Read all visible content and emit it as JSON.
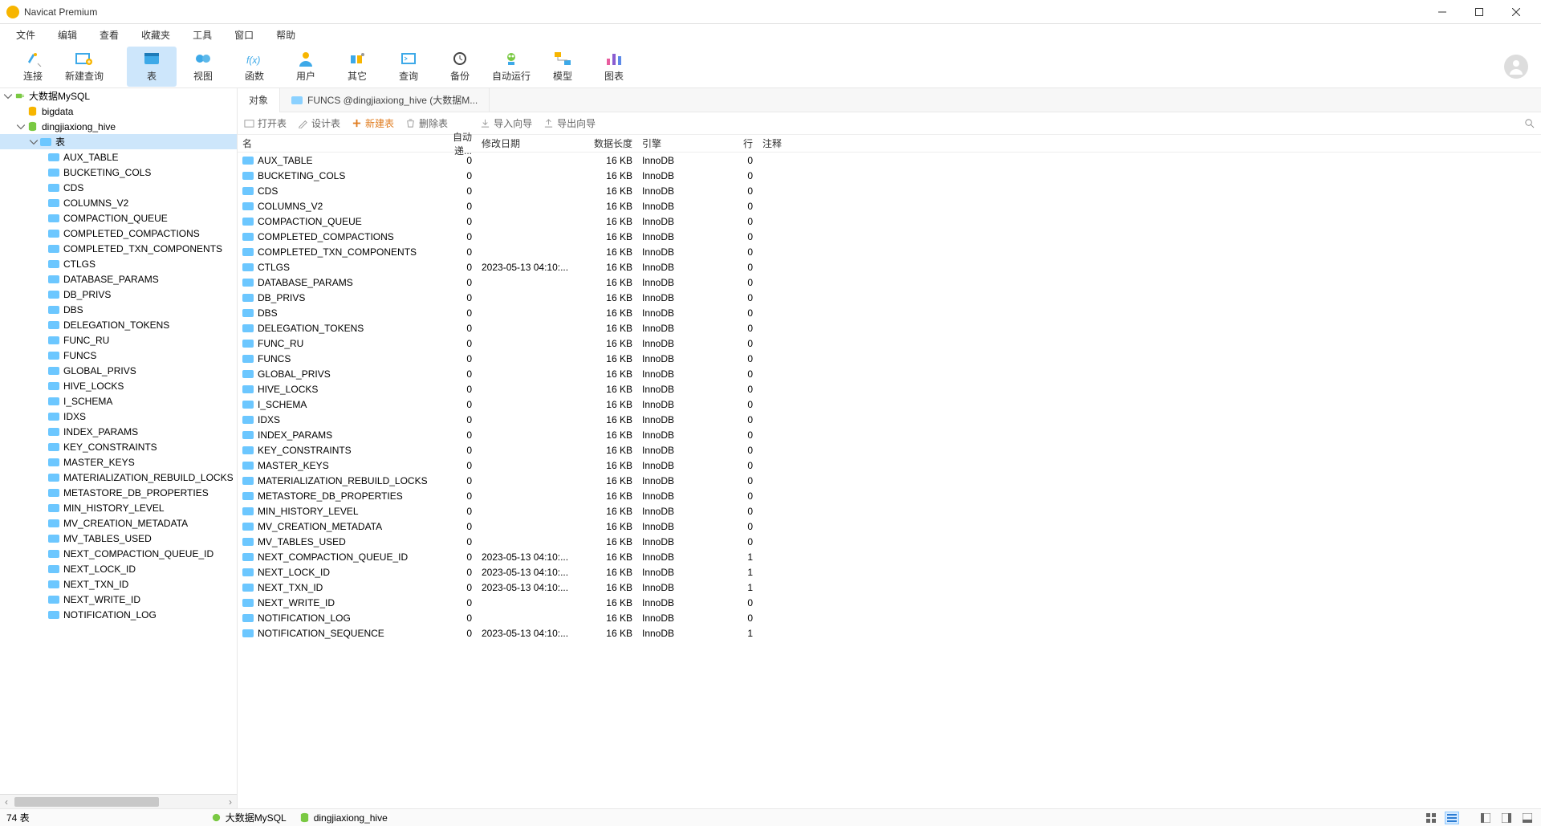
{
  "window": {
    "title": "Navicat Premium"
  },
  "menu": [
    "文件",
    "编辑",
    "查看",
    "收藏夹",
    "工具",
    "窗口",
    "帮助"
  ],
  "toolbar": [
    {
      "label": "连接",
      "key": "conn"
    },
    {
      "label": "新建查询",
      "key": "newq"
    },
    {
      "label": "表",
      "key": "table",
      "selected": true
    },
    {
      "label": "视图",
      "key": "view"
    },
    {
      "label": "函数",
      "key": "func"
    },
    {
      "label": "用户",
      "key": "user"
    },
    {
      "label": "其它",
      "key": "other"
    },
    {
      "label": "查询",
      "key": "query"
    },
    {
      "label": "备份",
      "key": "backup"
    },
    {
      "label": "自动运行",
      "key": "auto"
    },
    {
      "label": "模型",
      "key": "model"
    },
    {
      "label": "图表",
      "key": "chart"
    }
  ],
  "tree": {
    "root_label": "大数据MySQL",
    "db1_label": "bigdata",
    "db2_label": "dingjiaxiong_hive",
    "tables_label": "表",
    "tables": [
      "AUX_TABLE",
      "BUCKETING_COLS",
      "CDS",
      "COLUMNS_V2",
      "COMPACTION_QUEUE",
      "COMPLETED_COMPACTIONS",
      "COMPLETED_TXN_COMPONENTS",
      "CTLGS",
      "DATABASE_PARAMS",
      "DB_PRIVS",
      "DBS",
      "DELEGATION_TOKENS",
      "FUNC_RU",
      "FUNCS",
      "GLOBAL_PRIVS",
      "HIVE_LOCKS",
      "I_SCHEMA",
      "IDXS",
      "INDEX_PARAMS",
      "KEY_CONSTRAINTS",
      "MASTER_KEYS",
      "MATERIALIZATION_REBUILD_LOCKS",
      "METASTORE_DB_PROPERTIES",
      "MIN_HISTORY_LEVEL",
      "MV_CREATION_METADATA",
      "MV_TABLES_USED",
      "NEXT_COMPACTION_QUEUE_ID",
      "NEXT_LOCK_ID",
      "NEXT_TXN_ID",
      "NEXT_WRITE_ID",
      "NOTIFICATION_LOG"
    ]
  },
  "tabs": {
    "objects": "对象",
    "funcs": "FUNCS @dingjiaxiong_hive (大数据M..."
  },
  "subbar": {
    "open": "打开表",
    "design": "设计表",
    "new": "新建表",
    "delete": "删除表",
    "import": "导入向导",
    "export": "导出向导"
  },
  "columns": {
    "name": "名",
    "auto": "自动递...",
    "date": "修改日期",
    "size": "数据长度",
    "engine": "引擎",
    "rows": "行",
    "comment": "注释"
  },
  "grid": [
    {
      "name": "AUX_TABLE",
      "auto": "0",
      "date": "",
      "size": "16 KB",
      "engine": "InnoDB",
      "rows": "0"
    },
    {
      "name": "BUCKETING_COLS",
      "auto": "0",
      "date": "",
      "size": "16 KB",
      "engine": "InnoDB",
      "rows": "0"
    },
    {
      "name": "CDS",
      "auto": "0",
      "date": "",
      "size": "16 KB",
      "engine": "InnoDB",
      "rows": "0"
    },
    {
      "name": "COLUMNS_V2",
      "auto": "0",
      "date": "",
      "size": "16 KB",
      "engine": "InnoDB",
      "rows": "0"
    },
    {
      "name": "COMPACTION_QUEUE",
      "auto": "0",
      "date": "",
      "size": "16 KB",
      "engine": "InnoDB",
      "rows": "0"
    },
    {
      "name": "COMPLETED_COMPACTIONS",
      "auto": "0",
      "date": "",
      "size": "16 KB",
      "engine": "InnoDB",
      "rows": "0"
    },
    {
      "name": "COMPLETED_TXN_COMPONENTS",
      "auto": "0",
      "date": "",
      "size": "16 KB",
      "engine": "InnoDB",
      "rows": "0"
    },
    {
      "name": "CTLGS",
      "auto": "0",
      "date": "2023-05-13 04:10:...",
      "size": "16 KB",
      "engine": "InnoDB",
      "rows": "0"
    },
    {
      "name": "DATABASE_PARAMS",
      "auto": "0",
      "date": "",
      "size": "16 KB",
      "engine": "InnoDB",
      "rows": "0"
    },
    {
      "name": "DB_PRIVS",
      "auto": "0",
      "date": "",
      "size": "16 KB",
      "engine": "InnoDB",
      "rows": "0"
    },
    {
      "name": "DBS",
      "auto": "0",
      "date": "",
      "size": "16 KB",
      "engine": "InnoDB",
      "rows": "0"
    },
    {
      "name": "DELEGATION_TOKENS",
      "auto": "0",
      "date": "",
      "size": "16 KB",
      "engine": "InnoDB",
      "rows": "0"
    },
    {
      "name": "FUNC_RU",
      "auto": "0",
      "date": "",
      "size": "16 KB",
      "engine": "InnoDB",
      "rows": "0"
    },
    {
      "name": "FUNCS",
      "auto": "0",
      "date": "",
      "size": "16 KB",
      "engine": "InnoDB",
      "rows": "0"
    },
    {
      "name": "GLOBAL_PRIVS",
      "auto": "0",
      "date": "",
      "size": "16 KB",
      "engine": "InnoDB",
      "rows": "0"
    },
    {
      "name": "HIVE_LOCKS",
      "auto": "0",
      "date": "",
      "size": "16 KB",
      "engine": "InnoDB",
      "rows": "0"
    },
    {
      "name": "I_SCHEMA",
      "auto": "0",
      "date": "",
      "size": "16 KB",
      "engine": "InnoDB",
      "rows": "0"
    },
    {
      "name": "IDXS",
      "auto": "0",
      "date": "",
      "size": "16 KB",
      "engine": "InnoDB",
      "rows": "0"
    },
    {
      "name": "INDEX_PARAMS",
      "auto": "0",
      "date": "",
      "size": "16 KB",
      "engine": "InnoDB",
      "rows": "0"
    },
    {
      "name": "KEY_CONSTRAINTS",
      "auto": "0",
      "date": "",
      "size": "16 KB",
      "engine": "InnoDB",
      "rows": "0"
    },
    {
      "name": "MASTER_KEYS",
      "auto": "0",
      "date": "",
      "size": "16 KB",
      "engine": "InnoDB",
      "rows": "0"
    },
    {
      "name": "MATERIALIZATION_REBUILD_LOCKS",
      "auto": "0",
      "date": "",
      "size": "16 KB",
      "engine": "InnoDB",
      "rows": "0"
    },
    {
      "name": "METASTORE_DB_PROPERTIES",
      "auto": "0",
      "date": "",
      "size": "16 KB",
      "engine": "InnoDB",
      "rows": "0"
    },
    {
      "name": "MIN_HISTORY_LEVEL",
      "auto": "0",
      "date": "",
      "size": "16 KB",
      "engine": "InnoDB",
      "rows": "0"
    },
    {
      "name": "MV_CREATION_METADATA",
      "auto": "0",
      "date": "",
      "size": "16 KB",
      "engine": "InnoDB",
      "rows": "0"
    },
    {
      "name": "MV_TABLES_USED",
      "auto": "0",
      "date": "",
      "size": "16 KB",
      "engine": "InnoDB",
      "rows": "0"
    },
    {
      "name": "NEXT_COMPACTION_QUEUE_ID",
      "auto": "0",
      "date": "2023-05-13 04:10:...",
      "size": "16 KB",
      "engine": "InnoDB",
      "rows": "1"
    },
    {
      "name": "NEXT_LOCK_ID",
      "auto": "0",
      "date": "2023-05-13 04:10:...",
      "size": "16 KB",
      "engine": "InnoDB",
      "rows": "1"
    },
    {
      "name": "NEXT_TXN_ID",
      "auto": "0",
      "date": "2023-05-13 04:10:...",
      "size": "16 KB",
      "engine": "InnoDB",
      "rows": "1"
    },
    {
      "name": "NEXT_WRITE_ID",
      "auto": "0",
      "date": "",
      "size": "16 KB",
      "engine": "InnoDB",
      "rows": "0"
    },
    {
      "name": "NOTIFICATION_LOG",
      "auto": "0",
      "date": "",
      "size": "16 KB",
      "engine": "InnoDB",
      "rows": "0"
    },
    {
      "name": "NOTIFICATION_SEQUENCE",
      "auto": "0",
      "date": "2023-05-13 04:10:...",
      "size": "16 KB",
      "engine": "InnoDB",
      "rows": "1"
    }
  ],
  "status": {
    "count": "74 表",
    "conn": "大数据MySQL",
    "db": "dingjiaxiong_hive"
  }
}
